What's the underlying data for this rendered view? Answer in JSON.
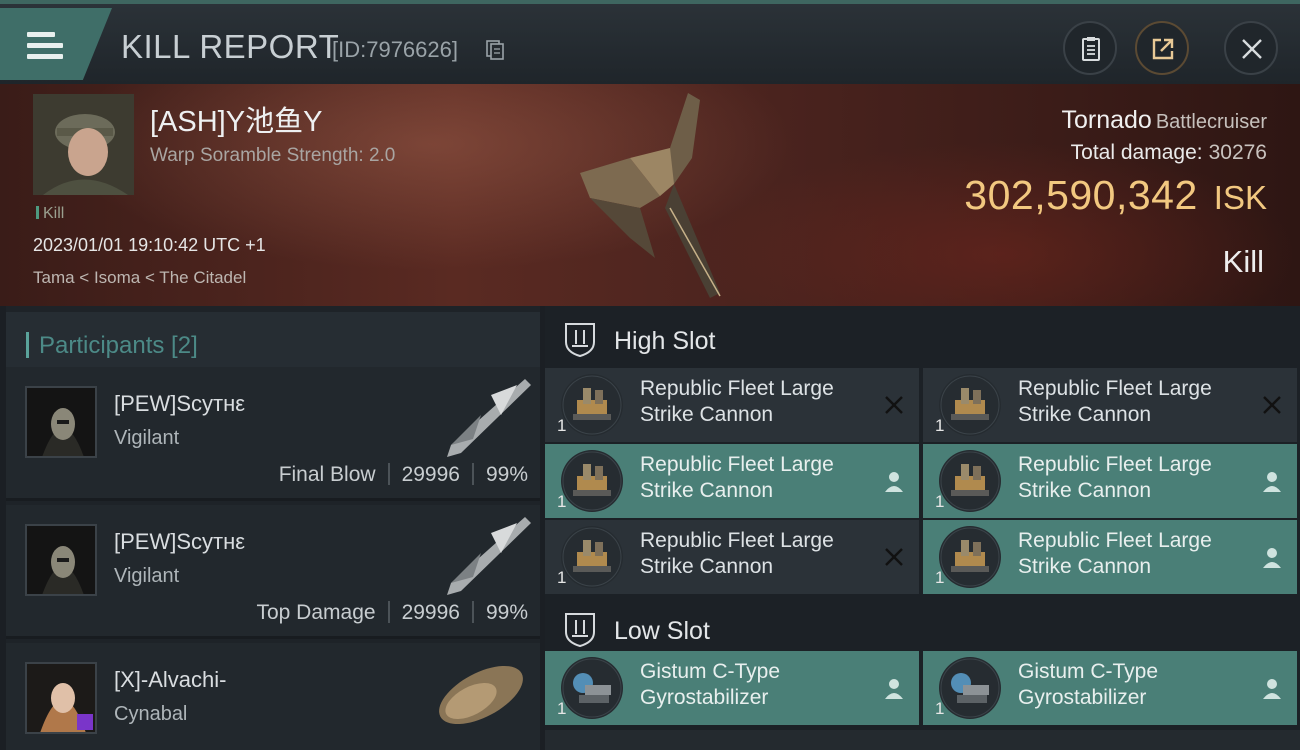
{
  "header": {
    "title": "KILL REPORT",
    "report_id": "[ID:7976626]",
    "icons": [
      "menu-icon",
      "copy-icon",
      "clipboard-icon",
      "share-icon",
      "close-icon"
    ]
  },
  "victim": {
    "name": "[ASH]Y池鱼Y",
    "subtitle": "Warp Soramble Strength: 2.0",
    "tag": "Kill",
    "datetime": "2023/01/01 19:10:42 UTC +1",
    "location": "Tama < Isoma < The Citadel",
    "ship_name": "Tornado",
    "ship_class": "Battlecruiser",
    "total_damage_label": "Total damage:",
    "total_damage": "30276",
    "isk_value": "302,590,342",
    "isk_unit": "ISK",
    "result": "Kill"
  },
  "participants": {
    "header": "Participants [2]",
    "rows": [
      {
        "name": "[PEW]Scyтнε",
        "ship": "Vigilant",
        "stat_label": "Final Blow",
        "damage": "29996",
        "percent": "99%"
      },
      {
        "name": "[PEW]Scyтнε",
        "ship": "Vigilant",
        "stat_label": "Top Damage",
        "damage": "29996",
        "percent": "99%"
      },
      {
        "name": "[X]-Alvachi-",
        "ship": "Cynabal",
        "stat_label": "",
        "damage": "",
        "percent": ""
      }
    ]
  },
  "fitting": {
    "high_slot_label": "High Slot",
    "low_slot_label": "Low Slot",
    "high_slots": [
      {
        "name": "Republic Fleet Large Strike Cannon",
        "qty": "1",
        "state": "destroyed"
      },
      {
        "name": "Republic Fleet Large Strike Cannon",
        "qty": "1",
        "state": "destroyed"
      },
      {
        "name": "Republic Fleet Large Strike Cannon",
        "qty": "1",
        "state": "dropped"
      },
      {
        "name": "Republic Fleet Large Strike Cannon",
        "qty": "1",
        "state": "dropped"
      },
      {
        "name": "Republic Fleet Large Strike Cannon",
        "qty": "1",
        "state": "destroyed"
      },
      {
        "name": "Republic Fleet Large Strike Cannon",
        "qty": "1",
        "state": "dropped"
      }
    ],
    "low_slots": [
      {
        "name": "Gistum C-Type Gyrostabilizer",
        "qty": "1",
        "state": "dropped"
      },
      {
        "name": "Gistum C-Type Gyrostabilizer",
        "qty": "1",
        "state": "dropped"
      }
    ]
  },
  "colors": {
    "accent_teal": "#4a7f77",
    "isk_gold": "#f2c880",
    "participants_header": "#4c8a87"
  }
}
